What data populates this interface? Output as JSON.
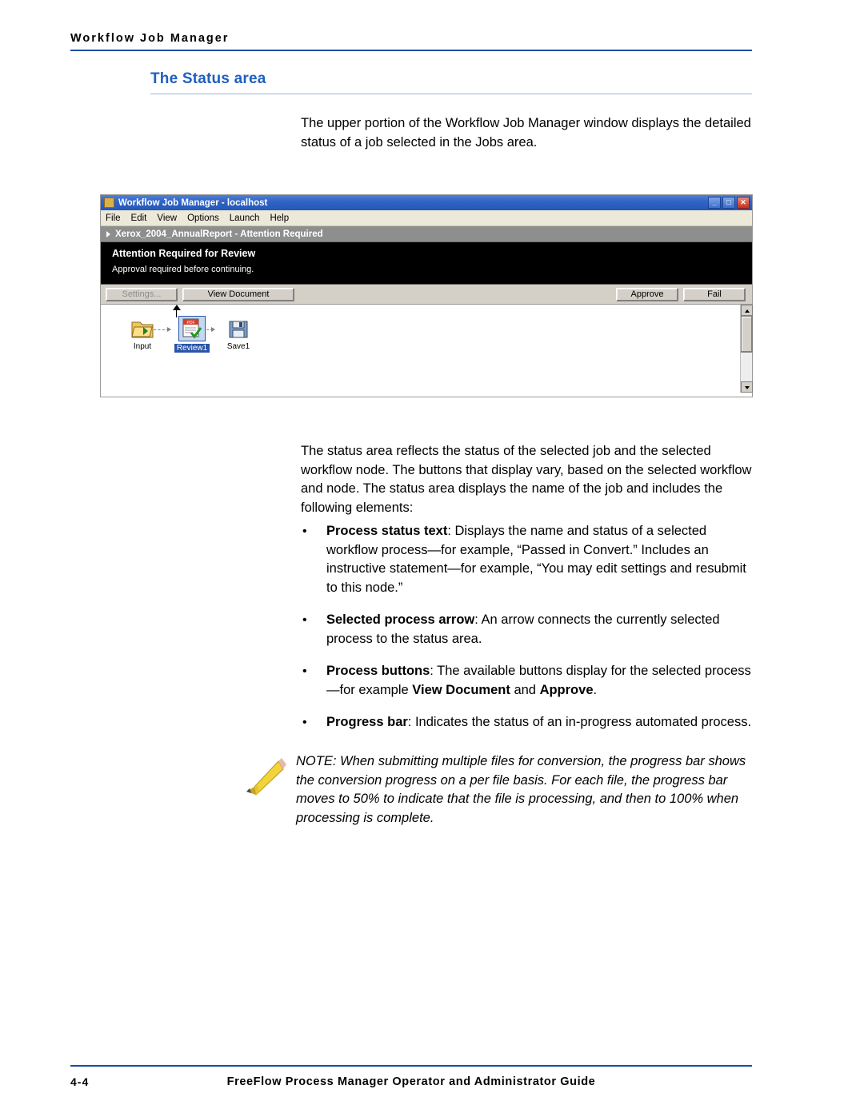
{
  "header": {
    "title": "Workflow Job Manager"
  },
  "section": {
    "title": "The Status area"
  },
  "paragraphs": {
    "intro": "The upper portion of the Workflow Job Manager window displays the detailed status of a job selected in the Jobs area.",
    "body": "The status area reflects the status of the selected job and the selected workflow node. The buttons that display vary, based on the selected workflow and node. The status area displays the name of the job and includes the following elements:"
  },
  "bullets": [
    {
      "marker": "•",
      "lead": "Process status text",
      "text": ": Displays the name and status of a selected workflow process—for example, “Passed in Convert.” Includes an instructive statement—for example, “You may edit settings and resubmit to this node.”"
    },
    {
      "marker": "•",
      "lead": "Selected process arrow",
      "text": ": An arrow connects the currently selected process to the status area."
    },
    {
      "marker": "•",
      "lead": "Process buttons",
      "text": ": The available buttons display for the selected process—for example ",
      "bold_inline_1": "View Document",
      "text2": " and ",
      "bold_inline_2": "Approve",
      "text3": "."
    },
    {
      "marker": "•",
      "lead": "Progress bar",
      "text": ": Indicates the status of an in-progress automated process."
    }
  ],
  "note": {
    "label": "NOTE:",
    "text": " When submitting multiple files for conversion, the progress bar shows the conversion progress on a per file basis. For each file, the progress bar moves to 50% to indicate that the file is processing, and then to 100% when processing is complete."
  },
  "figure": {
    "window_title": "Workflow Job Manager - localhost",
    "window_buttons": {
      "minimize": "_",
      "maximize": "□",
      "close": "✕"
    },
    "menus": [
      "File",
      "Edit",
      "View",
      "Options",
      "Launch",
      "Help"
    ],
    "breadcrumb": "Xerox_2004_AnnualReport - Attention Required",
    "status": {
      "title": "Attention Required for Review",
      "subtitle": "Approval required before continuing."
    },
    "buttons": {
      "settings": "Settings...",
      "view_document": "View Document",
      "approve": "Approve",
      "fail": "Fail"
    },
    "nodes": [
      {
        "label": "Input",
        "icon": "folder-icon",
        "selected": false
      },
      {
        "label": "Review1",
        "icon": "pdf-check-icon",
        "selected": true
      },
      {
        "label": "Save1",
        "icon": "floppy-disk-icon",
        "selected": false
      }
    ]
  },
  "footer": {
    "page": "4-4",
    "title": "FreeFlow Process Manager Operator and Administrator Guide"
  }
}
